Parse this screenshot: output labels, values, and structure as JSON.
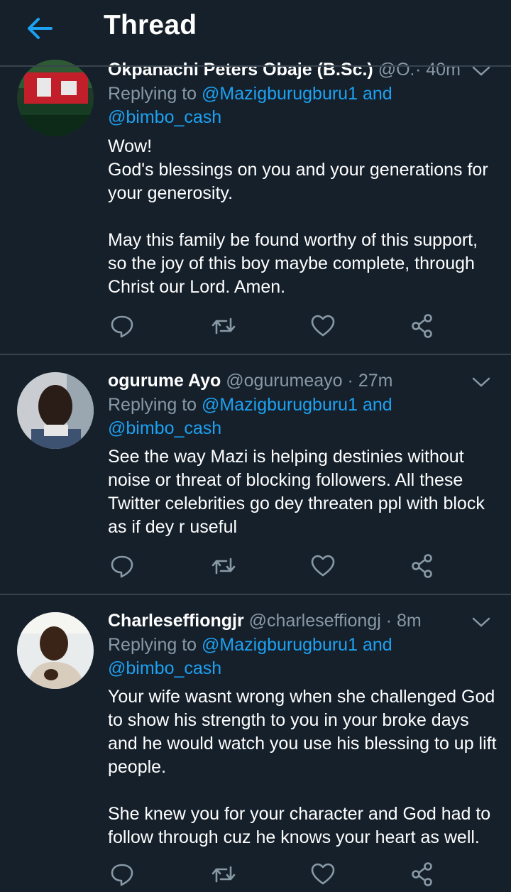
{
  "header": {
    "title": "Thread"
  },
  "tweets": [
    {
      "name": "Okpanachi Peters Obaje (B.Sc.)",
      "handle": "@O...",
      "time": "40m",
      "replying_prefix": "Replying to",
      "mention1": "@Mazigburugburu1",
      "and": "and",
      "mention2": "@bimbo_cash",
      "body": "Wow!\nGod's blessings on you and your generations for your generosity.\n\nMay this family be found worthy of this support, so the joy of this boy maybe complete, through Christ our Lord. Amen."
    },
    {
      "name": "ogurume Ayo",
      "handle": "@ogurumeayo",
      "time": "27m",
      "replying_prefix": "Replying to",
      "mention1": "@Mazigburugburu1",
      "and": "and",
      "mention2": "@bimbo_cash",
      "body": "See the way Mazi is helping destinies without noise or threat of blocking followers. All these Twitter celebrities go dey threaten ppl with block as if dey r useful"
    },
    {
      "name": "Charleseffiongjr",
      "handle": "@charleseffiongj",
      "time": "8m",
      "replying_prefix": "Replying to",
      "mention1": "@Mazigburugburu1",
      "and": "and",
      "mention2": "@bimbo_cash",
      "body": "Your wife wasnt wrong when she challenged God to show his strength to you in your broke days and he would watch you use his blessing to up lift people.\n\nShe knew you for your character and God had to follow through cuz he knows your heart as well."
    }
  ],
  "colors": {
    "background": "#15202b",
    "accent": "#1da1f2",
    "secondary_text": "#8899a6",
    "divider": "#38444d"
  },
  "icons": [
    "back-arrow-icon",
    "chevron-down-icon",
    "reply-icon",
    "retweet-icon",
    "like-icon",
    "share-icon"
  ]
}
